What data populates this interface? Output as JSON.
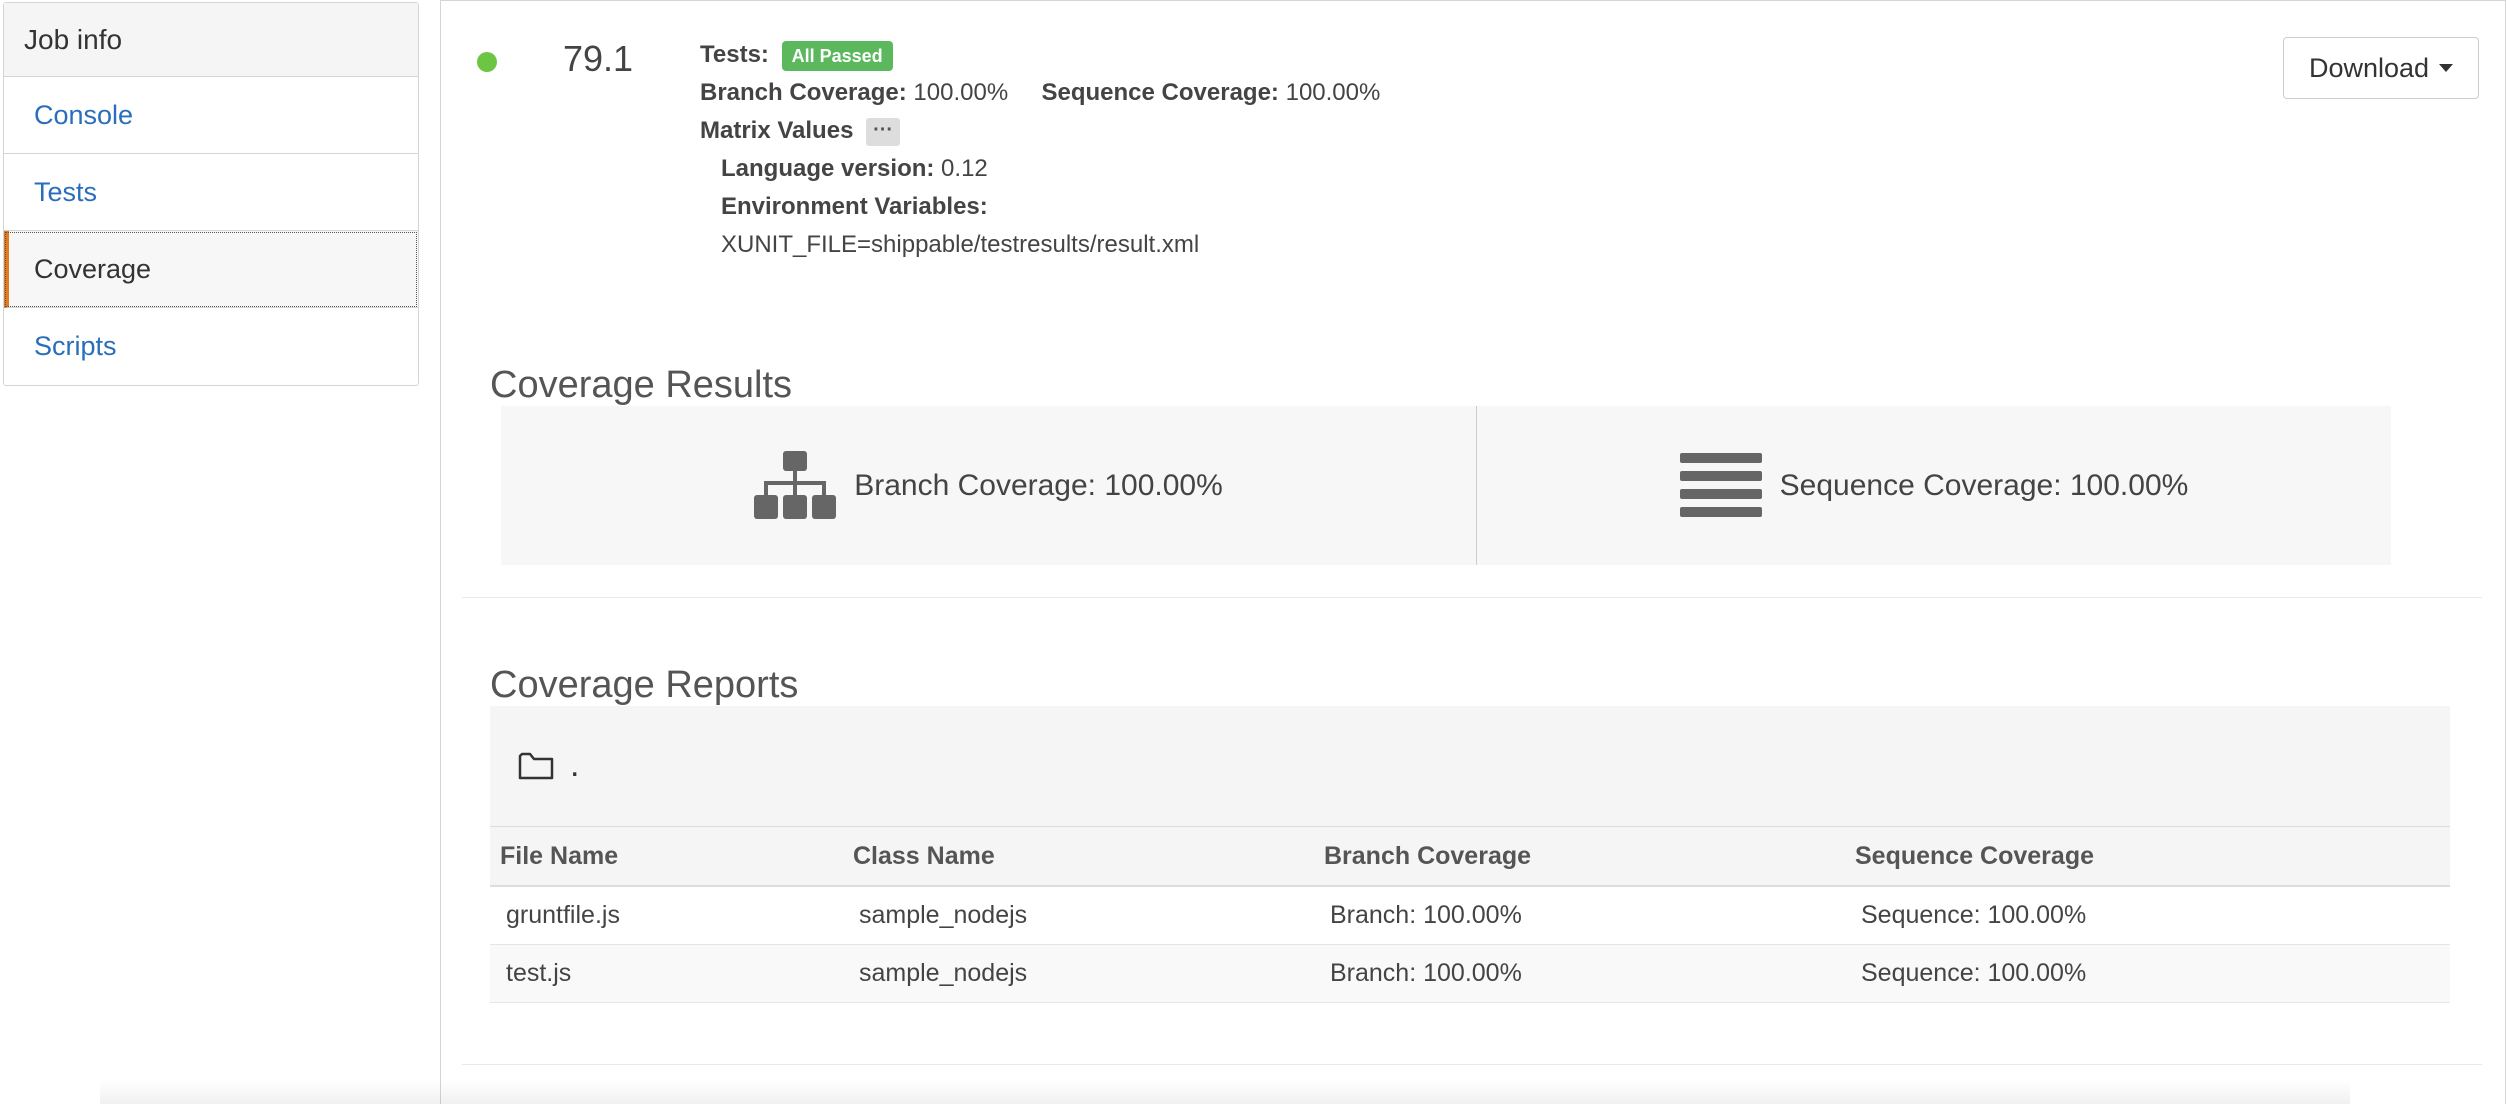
{
  "sidebar": {
    "title": "Job info",
    "items": [
      {
        "label": "Console"
      },
      {
        "label": "Tests"
      },
      {
        "label": "Coverage"
      },
      {
        "label": "Scripts"
      }
    ]
  },
  "job": {
    "status_color": "#6cc644",
    "number": "79.1",
    "tests_label": "Tests:",
    "tests_badge": "All Passed",
    "branch_label": "Branch Coverage:",
    "branch_value": "100.00%",
    "sequence_label": "Sequence Coverage:",
    "sequence_value": "100.00%",
    "matrix_label": "Matrix Values",
    "matrix_button": "···",
    "language_label": "Language version:",
    "language_value": "0.12",
    "env_label": "Environment Variables:",
    "env_value": "XUNIT_FILE=shippable/testresults/result.xml"
  },
  "download": {
    "label": "Download"
  },
  "coverage_results": {
    "title": "Coverage Results",
    "branch": "Branch Coverage: 100.00%",
    "sequence": "Sequence Coverage: 100.00%",
    "branch_icon": "sitemap-icon",
    "sequence_icon": "list-lines-icon"
  },
  "coverage_reports": {
    "title": "Coverage Reports",
    "folder_icon": "folder-icon",
    "folder_name": ".",
    "columns": [
      "File Name",
      "Class Name",
      "Branch Coverage",
      "Sequence Coverage"
    ],
    "rows": [
      {
        "file": "gruntfile.js",
        "class": "sample_nodejs",
        "branch": "Branch: 100.00%",
        "sequence": "Sequence: 100.00%"
      },
      {
        "file": "test.js",
        "class": "sample_nodejs",
        "branch": "Branch: 100.00%",
        "sequence": "Sequence: 100.00%"
      }
    ]
  },
  "colors": {
    "accent": "#e07b23",
    "link": "#2a6ebb",
    "success": "#5cb85c"
  }
}
